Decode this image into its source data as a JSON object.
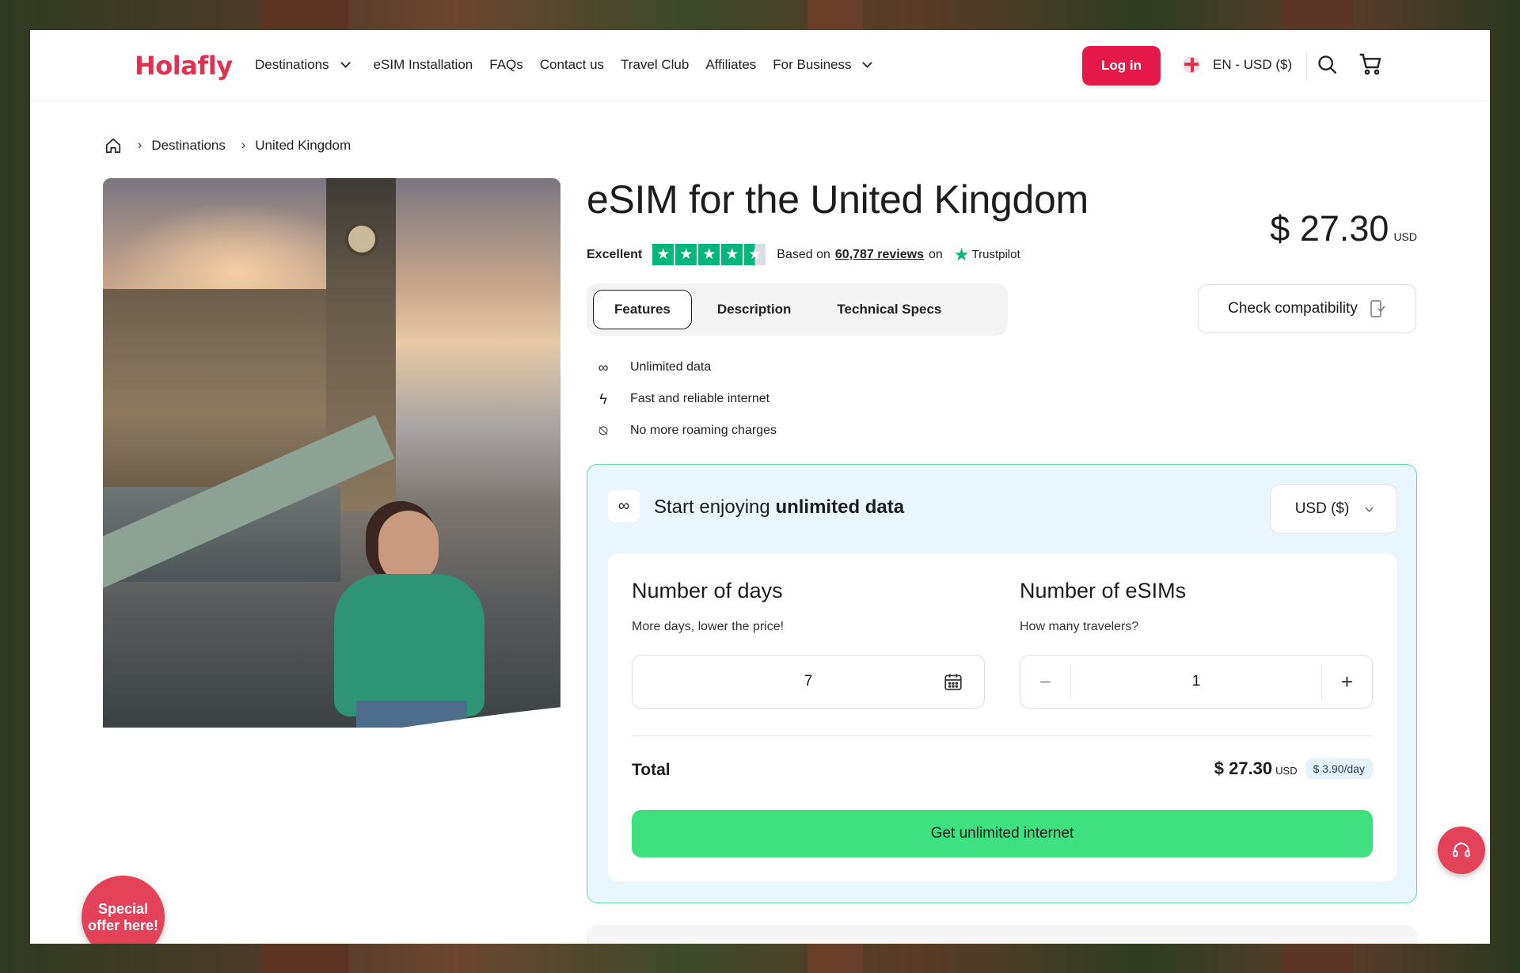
{
  "header": {
    "logo": "Holafly",
    "nav": [
      {
        "label": "Destinations",
        "dropdown": true
      },
      {
        "label": "eSIM Installation",
        "dropdown": false
      },
      {
        "label": "FAQs",
        "dropdown": false
      },
      {
        "label": "Contact us",
        "dropdown": false
      },
      {
        "label": "Travel Club",
        "dropdown": false
      },
      {
        "label": "Affiliates",
        "dropdown": false
      },
      {
        "label": "For Business",
        "dropdown": true
      }
    ],
    "login_label": "Log in",
    "language_currency": "EN - USD ($)",
    "icons": {
      "search": "search-icon",
      "cart": "cart-icon",
      "flag": "uk-flag-icon"
    },
    "brand_color": "#e5194a"
  },
  "breadcrumb": {
    "home_icon": "home-icon",
    "items": [
      "Destinations",
      "United Kingdom"
    ]
  },
  "product": {
    "title": "eSIM for the United Kingdom",
    "price": "$ 27.30",
    "price_currency": "USD",
    "rating": {
      "label": "Excellent",
      "stars": 4.5,
      "based_on": "Based on",
      "reviews": "60,787 reviews",
      "on": "on",
      "provider": "Trustpilot"
    },
    "tabs": [
      {
        "label": "Features",
        "active": true
      },
      {
        "label": "Description",
        "active": false
      },
      {
        "label": "Technical Specs",
        "active": false
      }
    ],
    "compatibility_label": "Check compatibility",
    "features": [
      {
        "icon": "infinity-icon",
        "label": "Unlimited data"
      },
      {
        "icon": "lightning-icon",
        "label": "Fast and reliable internet"
      },
      {
        "icon": "no-roaming-icon",
        "label": "No more roaming charges"
      }
    ]
  },
  "purchase": {
    "heading_prefix": "Start enjoying",
    "heading_bold": "unlimited data",
    "currency_select": "USD ($)",
    "days": {
      "title": "Number of days",
      "subtitle": "More days, lower the price!",
      "value": "7"
    },
    "esims": {
      "title": "Number of eSIMs",
      "subtitle": "How many travelers?",
      "value": "1"
    },
    "total_label": "Total",
    "total_value": "$ 27.30",
    "total_currency": "USD",
    "per_day": "$ 3.90/day",
    "cta_label": "Get unlimited internet",
    "accent_color": "#3ee07f",
    "border_color": "#58dd99"
  },
  "floating": {
    "special_offer": "Special offer here!",
    "support_icon": "support-headset-icon"
  }
}
